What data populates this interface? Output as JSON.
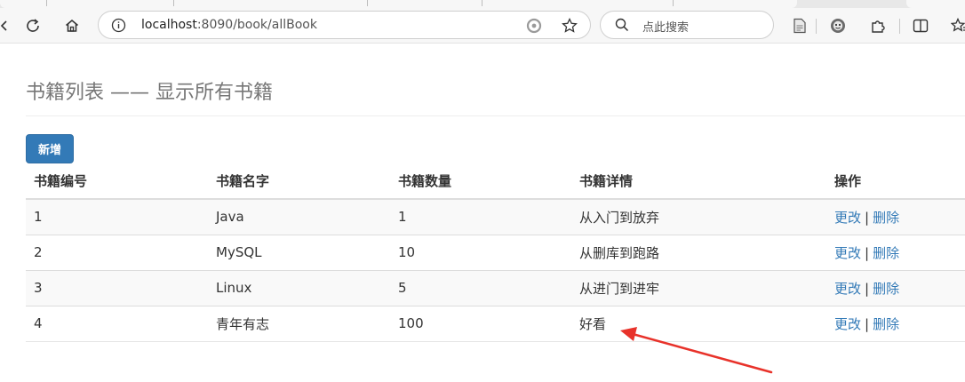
{
  "browser": {
    "url_host": "localhost",
    "url_rest": ":8090/book/allBook",
    "search_placeholder": "点此搜索",
    "accent": "#337ab7"
  },
  "page": {
    "title": "书籍列表 —— 显示所有书籍",
    "add_button": "新增"
  },
  "table": {
    "headers": [
      "书籍编号",
      "书籍名字",
      "书籍数量",
      "书籍详情",
      "操作"
    ],
    "rows": [
      {
        "id": "1",
        "name": "Java",
        "count": "1",
        "detail": "从入门到放弃",
        "edit": "更改",
        "sep": "|",
        "delete": "删除"
      },
      {
        "id": "2",
        "name": "MySQL",
        "count": "10",
        "detail": "从删库到跑路",
        "edit": "更改",
        "sep": "|",
        "delete": "删除"
      },
      {
        "id": "3",
        "name": "Linux",
        "count": "5",
        "detail": "从进门到进牢",
        "edit": "更改",
        "sep": "|",
        "delete": "删除"
      },
      {
        "id": "4",
        "name": "青年有志",
        "count": "100",
        "detail": "好看",
        "edit": "更改",
        "sep": "|",
        "delete": "删除"
      }
    ]
  },
  "annotation": {
    "color": "#e8322a"
  }
}
